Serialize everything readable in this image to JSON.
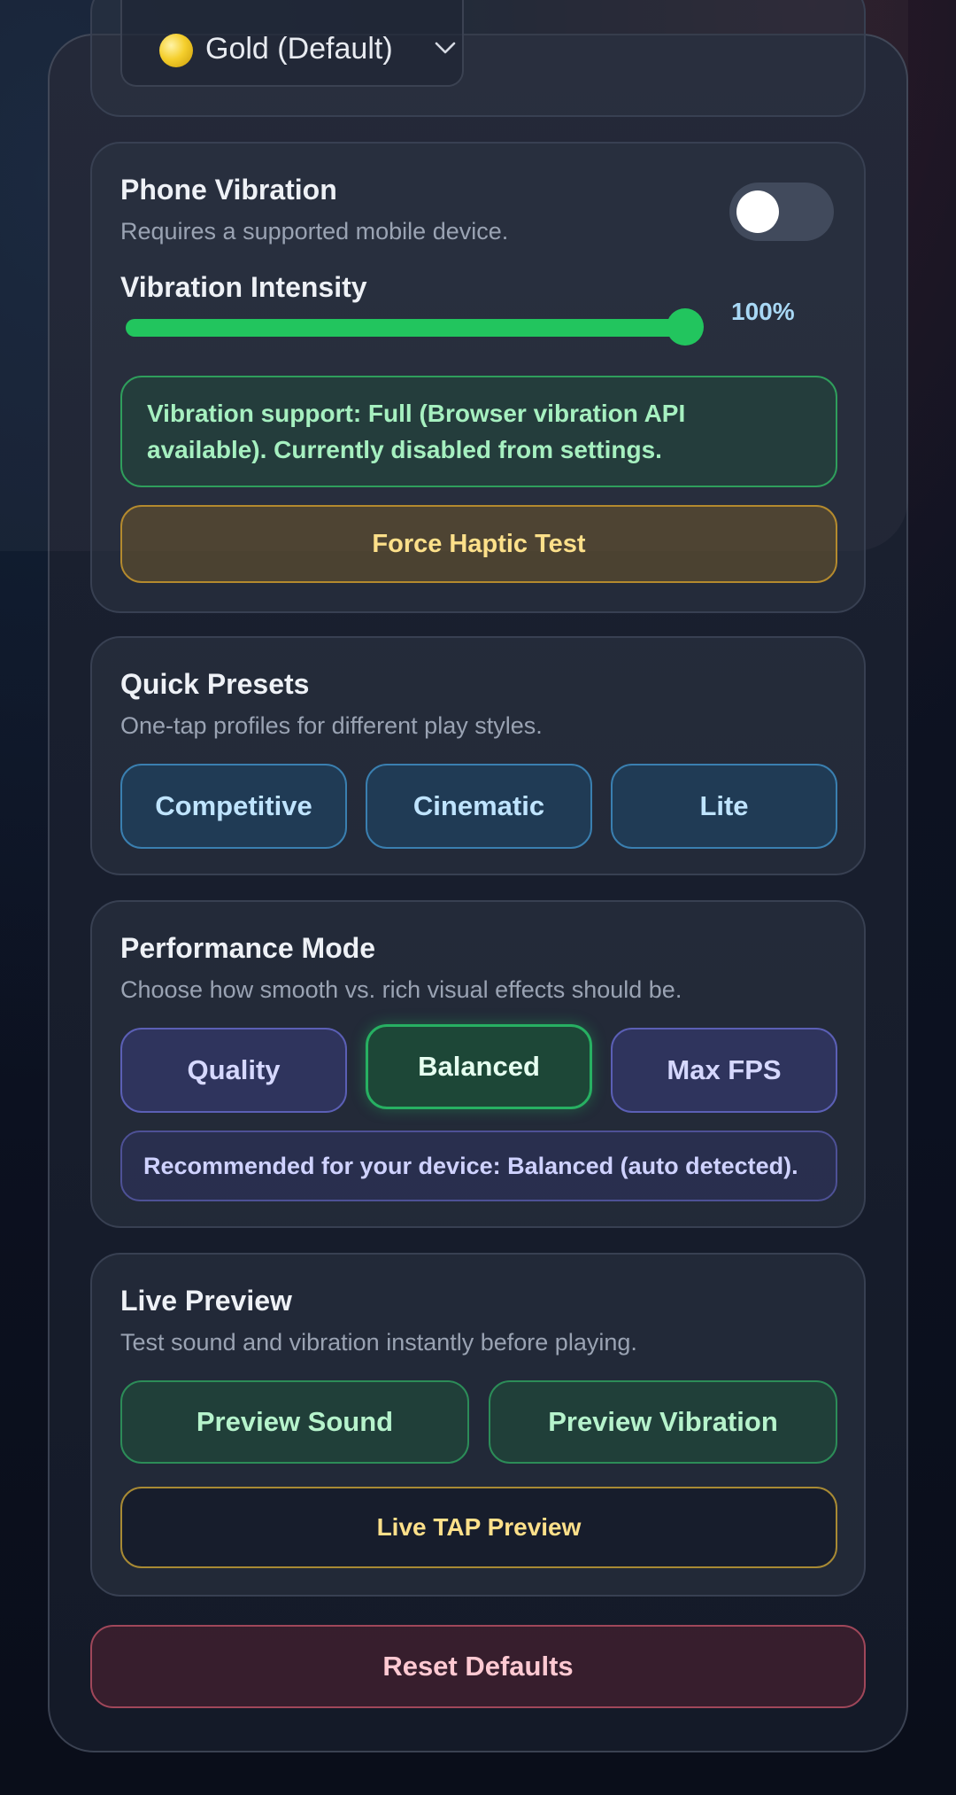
{
  "theme": {
    "accent_green": "#22c55e",
    "gold": "#f5cf2d",
    "danger": "#a0475a"
  },
  "color_select": {
    "value": "Gold (Default)",
    "icon": "gold-dot-icon"
  },
  "vibration": {
    "title": "Phone Vibration",
    "description": "Requires a supported mobile device.",
    "toggle_on": false,
    "intensity_label": "Vibration Intensity",
    "intensity_value": 100,
    "intensity_text": "100%",
    "status": "Vibration support: Full (Browser vibration API available). Currently disabled from settings.",
    "force_test_label": "Force Haptic Test"
  },
  "presets": {
    "title": "Quick Presets",
    "description": "One-tap profiles for different play styles.",
    "options": [
      "Competitive",
      "Cinematic",
      "Lite"
    ]
  },
  "performance": {
    "title": "Performance Mode",
    "description": "Choose how smooth vs. rich visual effects should be.",
    "options": [
      "Quality",
      "Balanced",
      "Max FPS"
    ],
    "selected": "Balanced",
    "recommendation": "Recommended for your device: Balanced (auto detected)."
  },
  "live_preview": {
    "title": "Live Preview",
    "description": "Test sound and vibration instantly before playing.",
    "sound_label": "Preview Sound",
    "vibration_label": "Preview Vibration",
    "tap_label": "Live TAP Preview"
  },
  "reset_label": "Reset Defaults"
}
